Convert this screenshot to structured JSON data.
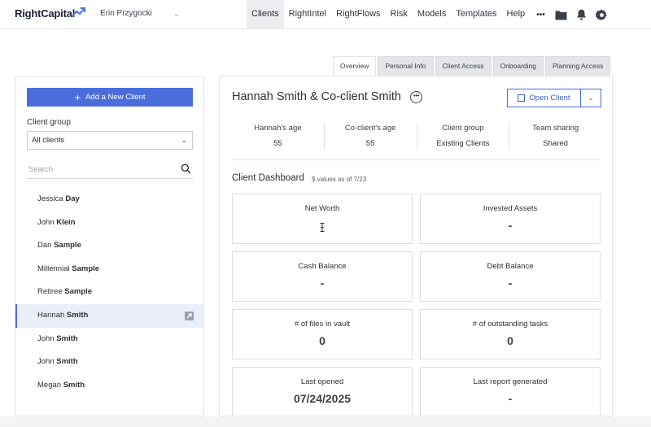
{
  "brand": {
    "name": "RightCapital"
  },
  "user": {
    "name": "Erin Przygocki"
  },
  "nav": {
    "items": [
      "Clients",
      "RightIntel",
      "RightFlows",
      "Risk",
      "Models",
      "Templates",
      "Help"
    ],
    "active": "Clients",
    "more_label": "•••"
  },
  "tabs": [
    "Overview",
    "Personal Info",
    "Client Access",
    "Onboarding",
    "Planning Access"
  ],
  "sidebar": {
    "add_label": "Add a New Client",
    "client_group_label": "Client group",
    "client_group_value": "All clients",
    "search_placeholder": "Search",
    "clients": [
      {
        "first": "Jessica",
        "last": "Day"
      },
      {
        "first": "John",
        "last": "Klein"
      },
      {
        "first": "Dan",
        "last": "Sample"
      },
      {
        "first": "Millennial",
        "last": "Sample"
      },
      {
        "first": "Retiree",
        "last": "Sample"
      },
      {
        "first": "Hannah",
        "last": "Smith"
      },
      {
        "first": "John",
        "last": "Smith"
      },
      {
        "first": "John",
        "last": "Smith"
      },
      {
        "first": "Megan",
        "last": "Smith"
      }
    ]
  },
  "client": {
    "name": "Hannah Smith & Co-client Smith",
    "open_label": "Open Client",
    "stats": [
      {
        "label": "Hannah's age",
        "value": "55"
      },
      {
        "label": "Co-client's age",
        "value": "55"
      },
      {
        "label": "Client group",
        "value": "Existing Clients"
      },
      {
        "label": "Team sharing",
        "value": "Shared"
      }
    ]
  },
  "dashboard": {
    "title": "Client Dashboard",
    "note": "$ values as of 7/23",
    "cards": [
      {
        "label": "Net Worth",
        "value": ""
      },
      {
        "label": "Invested Assets",
        "value": "-"
      },
      {
        "label": "Cash Balance",
        "value": "-"
      },
      {
        "label": "Debt Balance",
        "value": "-"
      },
      {
        "label": "# of files in vault",
        "value": "0"
      },
      {
        "label": "# of outstanding tasks",
        "value": "0"
      },
      {
        "label": "Last opened",
        "value": "07/24/2025"
      },
      {
        "label": "Last report generated",
        "value": "-"
      }
    ]
  },
  "colors": {
    "accent": "#4b6ddb",
    "nav_active_bg": "#ecedf0",
    "selected_bg": "#eaeef8"
  },
  "icons": [
    "logo-arrow-icon",
    "chevron-down-icon",
    "folder-icon",
    "bell-icon",
    "gear-icon",
    "plus-icon",
    "search-icon",
    "more-icon",
    "external-link-icon",
    "text-cursor-icon"
  ]
}
